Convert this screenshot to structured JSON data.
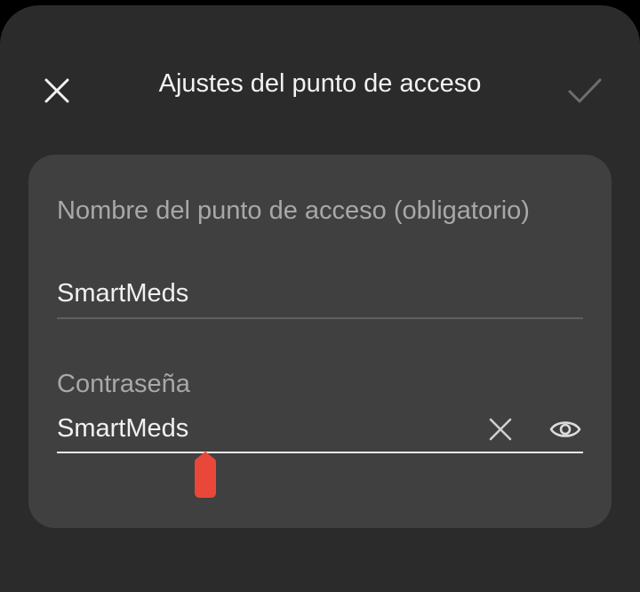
{
  "header": {
    "title": "Ajustes del punto de acceso",
    "close_icon": "close-icon",
    "confirm_icon": "check-icon"
  },
  "form": {
    "hotspot_name": {
      "label": "Nombre del punto de acceso (obligatorio)",
      "value": "SmartMeds"
    },
    "password": {
      "label": "Contraseña",
      "value": "SmartMeds",
      "clear_icon": "clear-text-icon",
      "visibility_icon": "eye-icon"
    }
  },
  "colors": {
    "background": "#2b2b2b",
    "card": "#404040",
    "label": "#a8a8a8",
    "text": "#f0f0f0",
    "cursor_handle": "#e8473a"
  }
}
